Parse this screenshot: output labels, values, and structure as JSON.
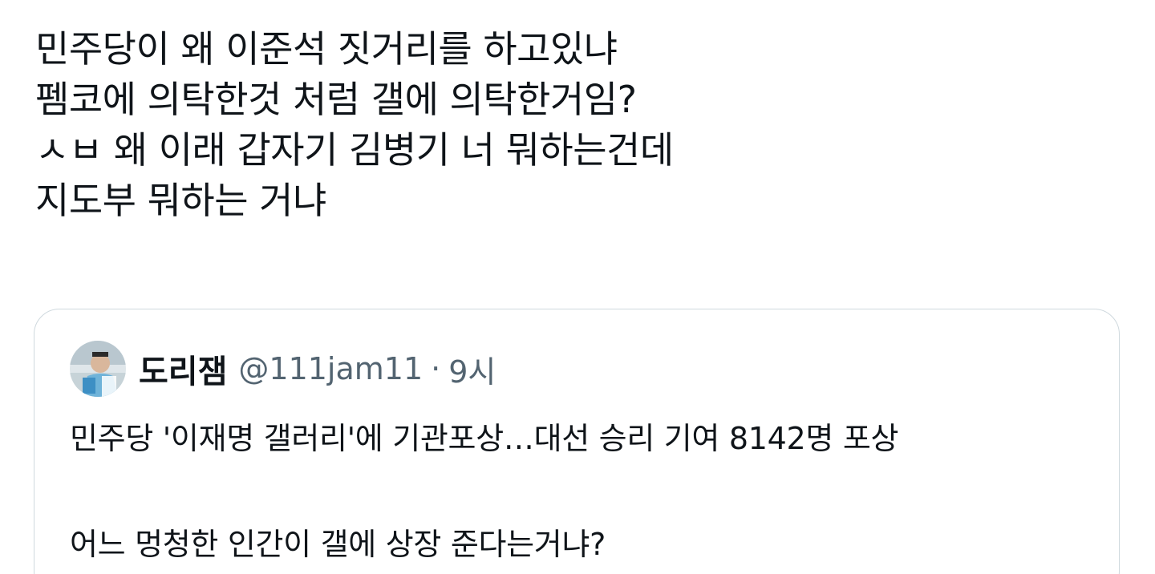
{
  "tweet": {
    "lines": [
      "민주당이 왜 이준석 짓거리를 하고있냐",
      "펨코에 의탁한것 처럼 갤에 의탁한거임?",
      "ㅅㅂ 왜 이래 갑자기 김병기 너 뭐하는건데",
      "지도부 뭐하는 거냐"
    ]
  },
  "quote": {
    "author_name": "도리잼",
    "handle": "@111jam11",
    "separator": "·",
    "time": "9시",
    "avatar_icon": "profile-photo",
    "lines": [
      "민주당 '이재명 갤러리'에 기관포상…대선 승리 기여 8142명 포상",
      "어느 멍청한 인간이 갤에 상장 준다는거냐?"
    ]
  },
  "colors": {
    "text_primary": "#0f1419",
    "text_secondary": "#536471",
    "border": "#cfd9de"
  }
}
